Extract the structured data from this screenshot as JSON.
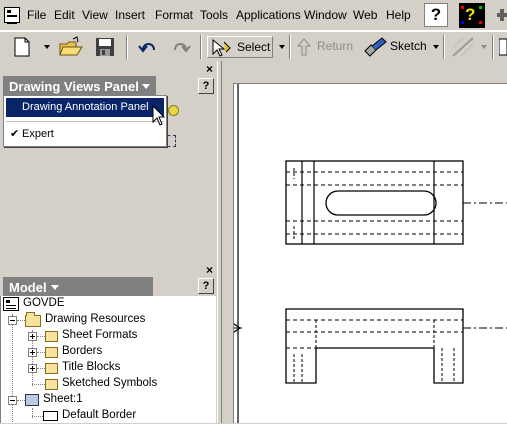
{
  "menubar": {
    "items": [
      "File",
      "Edit",
      "View",
      "Insert",
      "Format",
      "Tools",
      "Applications",
      "Window",
      "Web",
      "Help"
    ]
  },
  "toolbar": {
    "select_label": "Select",
    "return_label": "Return",
    "sketch_label": "Sketch"
  },
  "drawing_views_panel": {
    "title": "Drawing Views Panel",
    "dropdown": {
      "selected": "Drawing Annotation Panel",
      "expert": "Expert"
    }
  },
  "model_panel": {
    "title": "Model",
    "tree": [
      {
        "label": "GOVDE",
        "icon": "drawing-doc-icon"
      },
      {
        "label": "Drawing Resources",
        "icon": "folder-icon"
      },
      {
        "label": "Sheet Formats",
        "icon": "folder-icon"
      },
      {
        "label": "Borders",
        "icon": "folder-icon"
      },
      {
        "label": "Title Blocks",
        "icon": "folder-icon"
      },
      {
        "label": "Sketched Symbols",
        "icon": "folder-icon"
      },
      {
        "label": "Sheet:1",
        "icon": "sheet-icon"
      },
      {
        "label": "Default Border",
        "icon": "border-icon"
      }
    ]
  },
  "colors": {
    "chrome": "#d4d0c8",
    "panel_header": "#808080",
    "selection": "#0a246a"
  }
}
